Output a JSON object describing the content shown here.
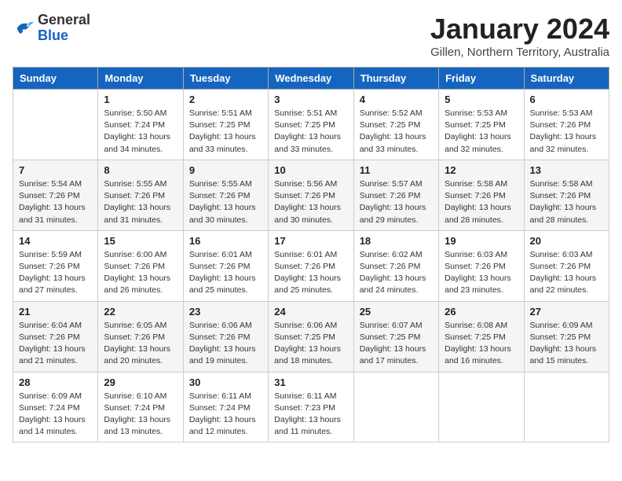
{
  "header": {
    "logo_general": "General",
    "logo_blue": "Blue",
    "title": "January 2024",
    "subtitle": "Gillen, Northern Territory, Australia"
  },
  "days_of_week": [
    "Sunday",
    "Monday",
    "Tuesday",
    "Wednesday",
    "Thursday",
    "Friday",
    "Saturday"
  ],
  "weeks": [
    [
      {
        "num": "",
        "info": ""
      },
      {
        "num": "1",
        "info": "Sunrise: 5:50 AM\nSunset: 7:24 PM\nDaylight: 13 hours\nand 34 minutes."
      },
      {
        "num": "2",
        "info": "Sunrise: 5:51 AM\nSunset: 7:25 PM\nDaylight: 13 hours\nand 33 minutes."
      },
      {
        "num": "3",
        "info": "Sunrise: 5:51 AM\nSunset: 7:25 PM\nDaylight: 13 hours\nand 33 minutes."
      },
      {
        "num": "4",
        "info": "Sunrise: 5:52 AM\nSunset: 7:25 PM\nDaylight: 13 hours\nand 33 minutes."
      },
      {
        "num": "5",
        "info": "Sunrise: 5:53 AM\nSunset: 7:25 PM\nDaylight: 13 hours\nand 32 minutes."
      },
      {
        "num": "6",
        "info": "Sunrise: 5:53 AM\nSunset: 7:26 PM\nDaylight: 13 hours\nand 32 minutes."
      }
    ],
    [
      {
        "num": "7",
        "info": "Sunrise: 5:54 AM\nSunset: 7:26 PM\nDaylight: 13 hours\nand 31 minutes."
      },
      {
        "num": "8",
        "info": "Sunrise: 5:55 AM\nSunset: 7:26 PM\nDaylight: 13 hours\nand 31 minutes."
      },
      {
        "num": "9",
        "info": "Sunrise: 5:55 AM\nSunset: 7:26 PM\nDaylight: 13 hours\nand 30 minutes."
      },
      {
        "num": "10",
        "info": "Sunrise: 5:56 AM\nSunset: 7:26 PM\nDaylight: 13 hours\nand 30 minutes."
      },
      {
        "num": "11",
        "info": "Sunrise: 5:57 AM\nSunset: 7:26 PM\nDaylight: 13 hours\nand 29 minutes."
      },
      {
        "num": "12",
        "info": "Sunrise: 5:58 AM\nSunset: 7:26 PM\nDaylight: 13 hours\nand 28 minutes."
      },
      {
        "num": "13",
        "info": "Sunrise: 5:58 AM\nSunset: 7:26 PM\nDaylight: 13 hours\nand 28 minutes."
      }
    ],
    [
      {
        "num": "14",
        "info": "Sunrise: 5:59 AM\nSunset: 7:26 PM\nDaylight: 13 hours\nand 27 minutes."
      },
      {
        "num": "15",
        "info": "Sunrise: 6:00 AM\nSunset: 7:26 PM\nDaylight: 13 hours\nand 26 minutes."
      },
      {
        "num": "16",
        "info": "Sunrise: 6:01 AM\nSunset: 7:26 PM\nDaylight: 13 hours\nand 25 minutes."
      },
      {
        "num": "17",
        "info": "Sunrise: 6:01 AM\nSunset: 7:26 PM\nDaylight: 13 hours\nand 25 minutes."
      },
      {
        "num": "18",
        "info": "Sunrise: 6:02 AM\nSunset: 7:26 PM\nDaylight: 13 hours\nand 24 minutes."
      },
      {
        "num": "19",
        "info": "Sunrise: 6:03 AM\nSunset: 7:26 PM\nDaylight: 13 hours\nand 23 minutes."
      },
      {
        "num": "20",
        "info": "Sunrise: 6:03 AM\nSunset: 7:26 PM\nDaylight: 13 hours\nand 22 minutes."
      }
    ],
    [
      {
        "num": "21",
        "info": "Sunrise: 6:04 AM\nSunset: 7:26 PM\nDaylight: 13 hours\nand 21 minutes."
      },
      {
        "num": "22",
        "info": "Sunrise: 6:05 AM\nSunset: 7:26 PM\nDaylight: 13 hours\nand 20 minutes."
      },
      {
        "num": "23",
        "info": "Sunrise: 6:06 AM\nSunset: 7:26 PM\nDaylight: 13 hours\nand 19 minutes."
      },
      {
        "num": "24",
        "info": "Sunrise: 6:06 AM\nSunset: 7:25 PM\nDaylight: 13 hours\nand 18 minutes."
      },
      {
        "num": "25",
        "info": "Sunrise: 6:07 AM\nSunset: 7:25 PM\nDaylight: 13 hours\nand 17 minutes."
      },
      {
        "num": "26",
        "info": "Sunrise: 6:08 AM\nSunset: 7:25 PM\nDaylight: 13 hours\nand 16 minutes."
      },
      {
        "num": "27",
        "info": "Sunrise: 6:09 AM\nSunset: 7:25 PM\nDaylight: 13 hours\nand 15 minutes."
      }
    ],
    [
      {
        "num": "28",
        "info": "Sunrise: 6:09 AM\nSunset: 7:24 PM\nDaylight: 13 hours\nand 14 minutes."
      },
      {
        "num": "29",
        "info": "Sunrise: 6:10 AM\nSunset: 7:24 PM\nDaylight: 13 hours\nand 13 minutes."
      },
      {
        "num": "30",
        "info": "Sunrise: 6:11 AM\nSunset: 7:24 PM\nDaylight: 13 hours\nand 12 minutes."
      },
      {
        "num": "31",
        "info": "Sunrise: 6:11 AM\nSunset: 7:23 PM\nDaylight: 13 hours\nand 11 minutes."
      },
      {
        "num": "",
        "info": ""
      },
      {
        "num": "",
        "info": ""
      },
      {
        "num": "",
        "info": ""
      }
    ]
  ]
}
